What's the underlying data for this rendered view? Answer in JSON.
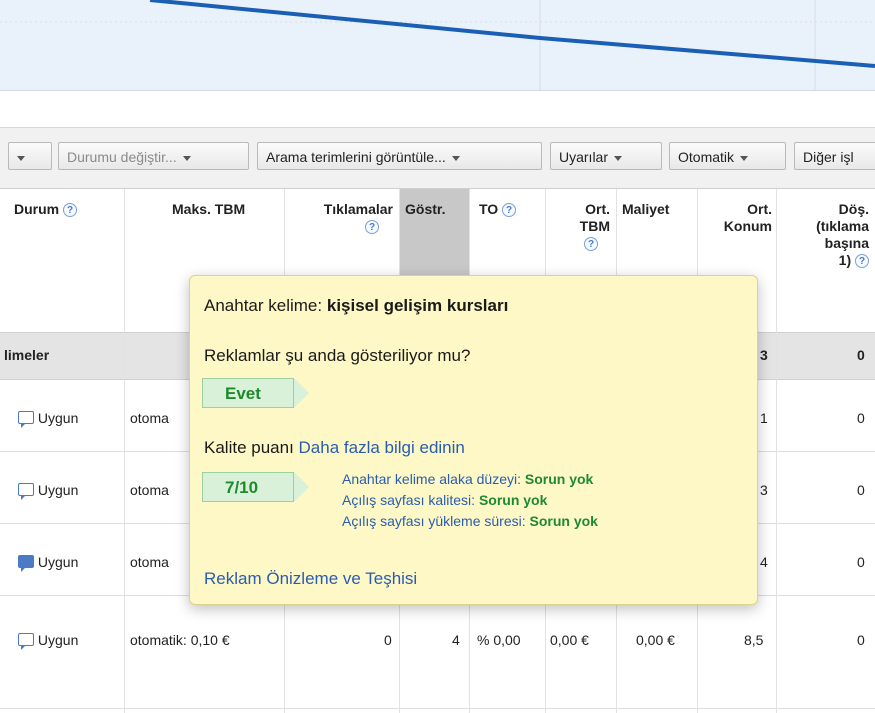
{
  "toolbar": {
    "first_caret": "",
    "status_change": "Durumu değiştir...",
    "search_terms": "Arama terimlerini görüntüle...",
    "alerts": "Uyarılar",
    "automatic": "Otomatik",
    "other": "Diğer işl"
  },
  "table": {
    "headers": {
      "durum": "Durum",
      "maks": "Maks. TBM",
      "tiklamalar": "Tıklamalar",
      "gostr": "Göstr.",
      "to": "TO",
      "ort_tbm_1": "Ort.",
      "ort_tbm_2": "TBM",
      "maliyet": "Maliyet",
      "ort_konum_1": "Ort.",
      "ort_konum_2": "Konum",
      "dons_1": "Döş.",
      "dons_2": "(tıklama",
      "dons_3": "başına",
      "dons_4": "1)"
    },
    "total_row": {
      "label": "limeler",
      "konum": "3",
      "dons": "0"
    },
    "rows": [
      {
        "status": "Uygun",
        "maks": "otoma",
        "konum": "1",
        "dons": "0"
      },
      {
        "status": "Uygun",
        "maks": "otoma",
        "konum": "3",
        "dons": "0"
      },
      {
        "status": "Uygun",
        "maks": "otoma",
        "konum": "4",
        "dons": "0"
      },
      {
        "status": "Uygun",
        "maks": "otomatik: 0,10 €",
        "tiklamalar": "0",
        "gostr": "4",
        "to": "% 0,00",
        "ort_tbm": "0,00 €",
        "maliyet": "0,00 €",
        "konum": "8,5",
        "dons": "0"
      }
    ]
  },
  "popup": {
    "keyword_label": "Anahtar kelime:",
    "keyword": "kişisel gelişim kursları",
    "showing_q": "Reklamlar şu anda gösteriliyor mu?",
    "showing_a": "Evet",
    "quality_label": "Kalite puanı",
    "quality_link": "Daha fazla bilgi edinin",
    "quality_score": "7/10",
    "details": [
      {
        "label": "Anahtar kelime alaka düzeyi:",
        "value": "Sorun yok"
      },
      {
        "label": "Açılış sayfası kalitesi:",
        "value": "Sorun yok"
      },
      {
        "label": "Açılış sayfası yükleme süresi:",
        "value": "Sorun yok"
      }
    ],
    "preview_link": "Reklam Önizleme ve Teşhisi"
  },
  "colors": {
    "chart_line": "#1a5fb4",
    "link": "#2a5db0",
    "ok_green": "#1e8a2e",
    "popup_bg": "#fdf8c6"
  }
}
